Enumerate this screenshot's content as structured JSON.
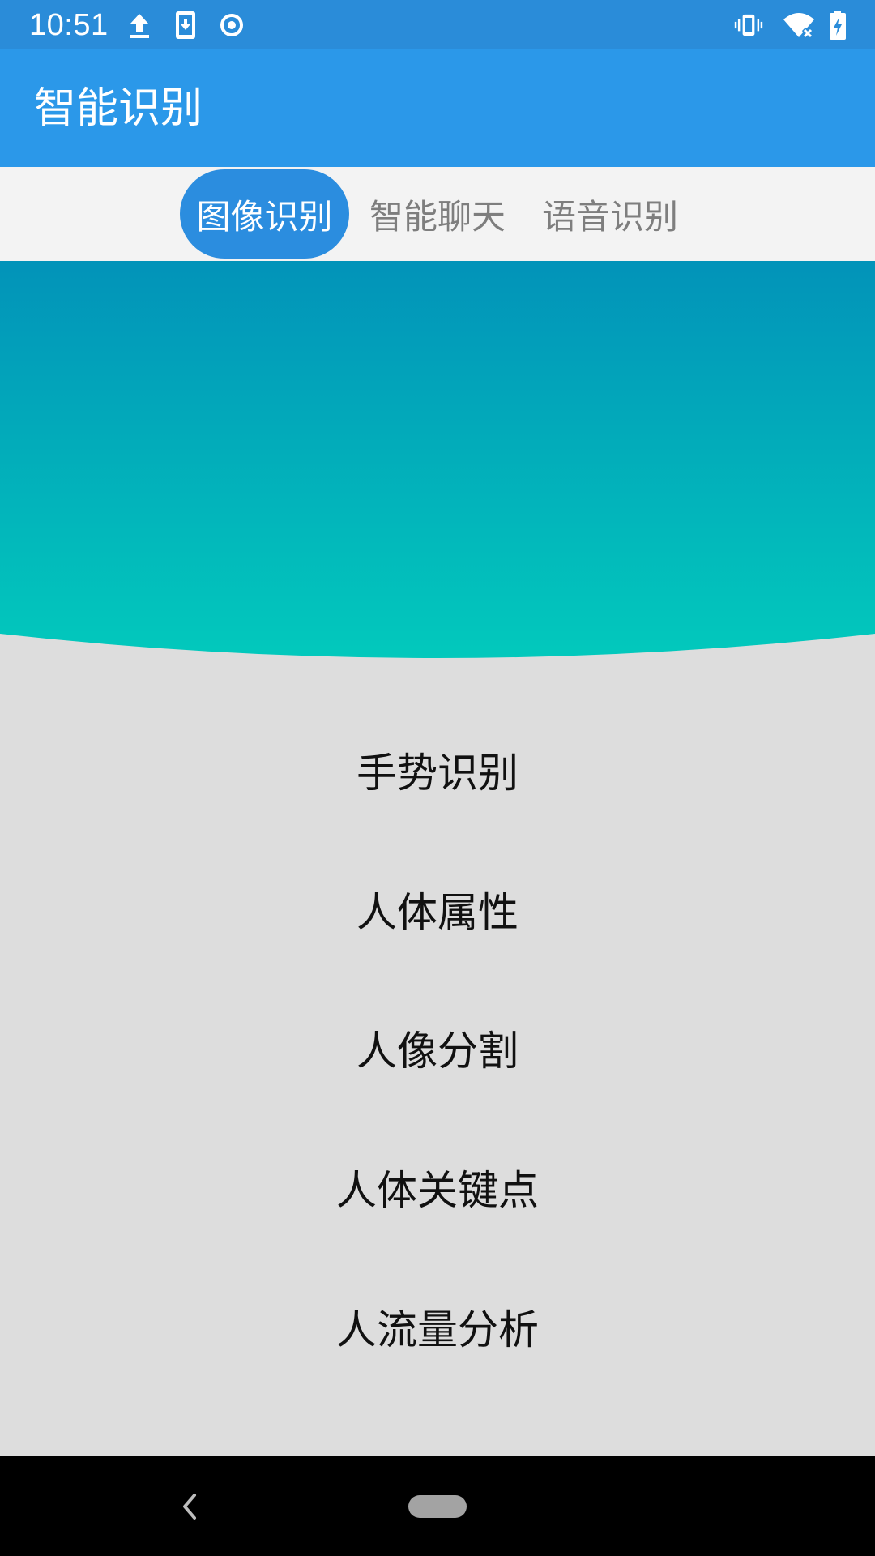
{
  "status_bar": {
    "time": "10:51",
    "icons": [
      "upload-icon",
      "download-phone-icon",
      "record-icon",
      "vibrate-icon",
      "wifi-icon",
      "battery-charging-icon"
    ]
  },
  "app_bar": {
    "title": "智能识别"
  },
  "tabs": [
    {
      "label": "图像识别",
      "active": true
    },
    {
      "label": "智能聊天",
      "active": false
    },
    {
      "label": "语音识别",
      "active": false
    }
  ],
  "menu": [
    {
      "label": "手势识别"
    },
    {
      "label": "人体属性"
    },
    {
      "label": "人像分割"
    },
    {
      "label": "人体关键点"
    },
    {
      "label": "人流量分析"
    }
  ],
  "nav_bar": {
    "icons": [
      "back-icon",
      "home-pill-icon"
    ]
  },
  "colors": {
    "status_bar": "#2a8cd9",
    "app_bar": "#2b98e9",
    "tab_active": "#2b8ddf",
    "banner_top": "#0293b9",
    "banner_bottom": "#02c9bc",
    "background": "#dddddd"
  }
}
